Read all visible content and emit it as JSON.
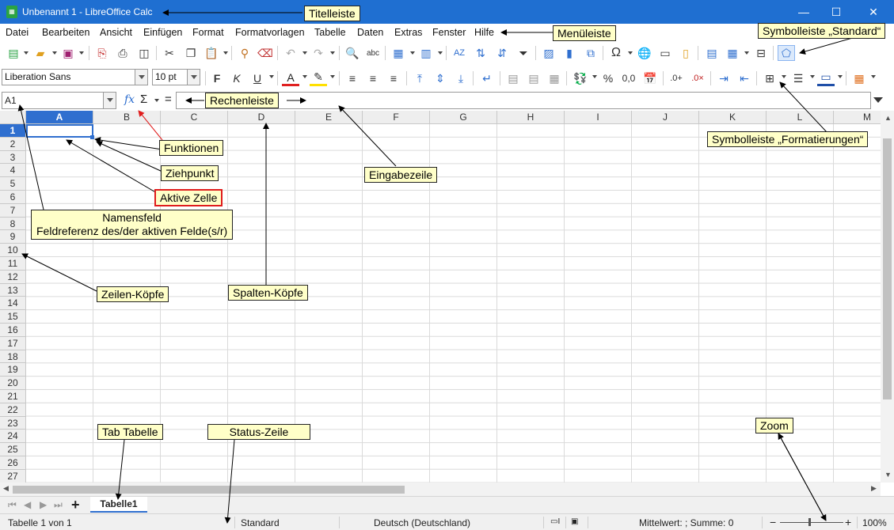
{
  "titlebar": {
    "title": "Unbenannt 1 - LibreOffice Calc",
    "minimize": "—",
    "maximize": "☐",
    "close": "✕"
  },
  "menu": [
    "Datei",
    "Bearbeiten",
    "Ansicht",
    "Einfügen",
    "Format",
    "Formatvorlagen",
    "Tabelle",
    "Daten",
    "Extras",
    "Fenster",
    "Hilfe"
  ],
  "toolbar_standard": {
    "icons": [
      "new-icon",
      "open-icon",
      "save-icon",
      "export-pdf-icon",
      "print-icon",
      "print-preview-icon",
      "cut-icon",
      "copy-icon",
      "paste-icon",
      "clone-format-icon",
      "clear-format-icon",
      "undo-icon",
      "redo-icon",
      "find-replace-icon",
      "spellcheck-icon",
      "row-icon",
      "column-icon",
      "sort-icon",
      "sort-ascending-icon",
      "sort-descending-icon",
      "autofilter-icon",
      "image-icon",
      "chart-icon",
      "pivot-table-icon",
      "special-character-icon",
      "hyperlink-icon",
      "comment-icon",
      "header-footer-icon",
      "define-print-area-icon",
      "freeze-rows-columns-icon",
      "split-window-icon",
      "show-draw-functions-icon"
    ]
  },
  "toolbar_format": {
    "font_name": "Liberation Sans",
    "font_size": "10 pt",
    "bold": "F",
    "italic": "K",
    "underline": "U",
    "font_color_letter": "A",
    "percent": "%",
    "number_format": "0,0",
    "colors": {
      "font_color": "#e02020",
      "highlight_color": "#ffe000",
      "border_color": "#1f4fa8"
    }
  },
  "formula": {
    "namebox_value": "A1",
    "fx": "fx",
    "sum": "Σ",
    "equals": "=",
    "input_value": ""
  },
  "grid": {
    "columns": [
      "A",
      "B",
      "C",
      "D",
      "E",
      "F",
      "G",
      "H",
      "I",
      "J",
      "K",
      "L",
      "M"
    ],
    "rows": [
      "1",
      "2",
      "3",
      "4",
      "5",
      "6",
      "7",
      "8",
      "9",
      "10",
      "11",
      "12",
      "13",
      "14",
      "15",
      "16",
      "17",
      "18",
      "19",
      "20",
      "21",
      "22",
      "23",
      "24",
      "25",
      "26",
      "27"
    ],
    "active_cell": "A1"
  },
  "tabs": {
    "sheet_name": "Tabelle1",
    "add_label": "+"
  },
  "status": {
    "sheet_info": "Tabelle 1 von 1",
    "page_style": "Standard",
    "language": "Deutsch (Deutschland)",
    "sum_info": "Mittelwert: ; Summe: 0",
    "zoom_minus": "−",
    "zoom_plus": "+",
    "zoom_value": "100%"
  },
  "annotations": {
    "titelleiste": "Titelleiste",
    "menueleiste": "Menüleiste",
    "symbolleiste_standard": "Symbolleiste „Standard“",
    "rechenleiste": "Rechenleiste",
    "funktionen": "Funktionen",
    "symbolleiste_format": "Symbolleiste „Formatierungen“",
    "ziehpunkt": "Ziehpunkt",
    "aktive_zelle": "Aktive Zelle",
    "eingabezeile": "Eingabezeile",
    "namensfeld_line1": "Namensfeld",
    "namensfeld_line2": "Feldreferenz des/der aktiven Felde(s/r)",
    "zeilen_koepfe": "Zeilen-Köpfe",
    "spalten_koepfe": "Spalten-Köpfe",
    "tab_tabelle": "Tab Tabelle",
    "status_zeile": "Status-Zeile",
    "zoom": "Zoom"
  }
}
